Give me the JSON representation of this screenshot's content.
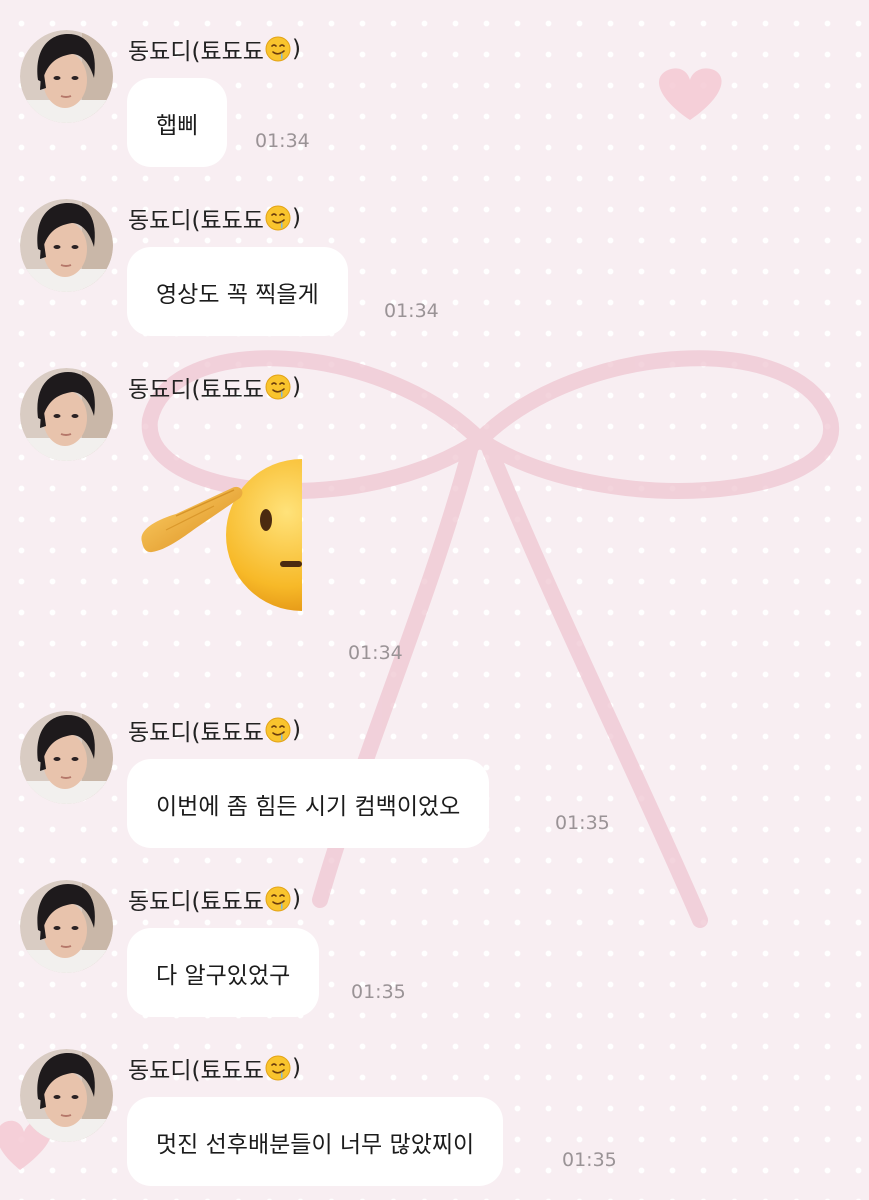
{
  "chat": {
    "sender_name": "동됴디(툐됴됴",
    "sender_suffix": ")",
    "sender_emoji_icon": "drooling-face-icon",
    "messages": [
      {
        "type": "text",
        "text": "햅삐",
        "time": "01:34"
      },
      {
        "type": "text",
        "text": "영상도 꼭 찍을게",
        "time": "01:34"
      },
      {
        "type": "emoji",
        "emoji_icon": "saluting-face-icon",
        "time": "01:34"
      },
      {
        "type": "text",
        "text": "이번에 좀 힘든 시기 컴백이었오",
        "time": "01:35"
      },
      {
        "type": "text",
        "text": "다 알구있었구",
        "time": "01:35"
      },
      {
        "type": "text",
        "text": "멋진 선후배분들이 너무 많았찌이",
        "time": "01:35"
      }
    ]
  },
  "colors": {
    "background": "#f8eef2",
    "bubble": "#ffffff",
    "timestamp": "#9a9396",
    "ribbon": "#f0c8d2"
  }
}
